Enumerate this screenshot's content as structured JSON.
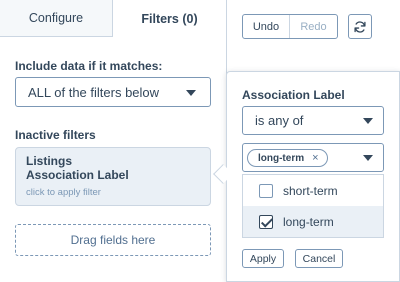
{
  "tabs": [
    {
      "label": "Configure"
    },
    {
      "label": "Filters (0)"
    }
  ],
  "filters": {
    "include_label": "Include data if it matches:",
    "match_value": "ALL of the filters below",
    "inactive_label": "Inactive filters",
    "inactive_card": {
      "line1": "Listings",
      "line2": "Association Label",
      "hint": "click to apply filter"
    },
    "drop_zone": "Drag fields here"
  },
  "toolbar": {
    "undo_label": "Undo",
    "redo_label": "Redo",
    "refresh_icon": "refresh-icon"
  },
  "popover": {
    "title": "Association Label",
    "operator": "is any of",
    "chips": [
      {
        "label": "long-term",
        "remove": "×"
      }
    ],
    "options": [
      {
        "label": "short-term",
        "checked": false
      },
      {
        "label": "long-term",
        "checked": true
      }
    ],
    "apply_label": "Apply",
    "cancel_label": "Cancel"
  },
  "colors": {
    "text": "#33475b",
    "border": "#7c98b6",
    "light_border": "#cbd6e2",
    "highlight": "#eaf0f6",
    "muted": "#99afc4"
  }
}
